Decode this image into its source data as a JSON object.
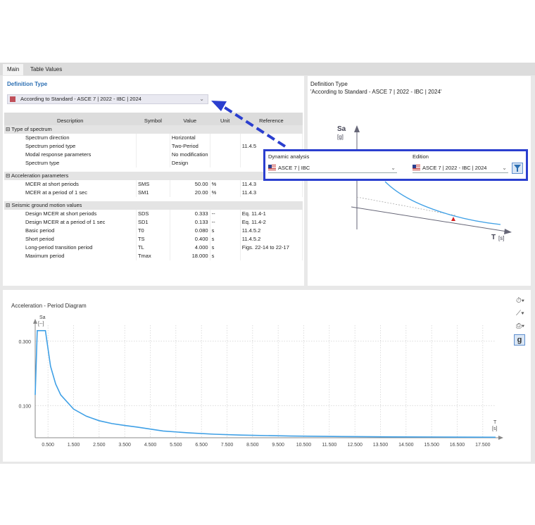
{
  "tabs": [
    "Main",
    "Table Values"
  ],
  "definition": {
    "title": "Definition Type",
    "selected": "According to Standard - ASCE 7 | 2022 - IBC | 2024"
  },
  "table": {
    "headers": [
      "Description",
      "Symbol",
      "Value",
      "Unit",
      "Reference"
    ],
    "groups": [
      {
        "title": "Type of spectrum",
        "rows": [
          {
            "desc": "Spectrum direction",
            "symbol": "",
            "value": "Horizontal",
            "unit": "",
            "ref": ""
          },
          {
            "desc": "Spectrum period type",
            "symbol": "",
            "value": "Two-Period",
            "unit": "",
            "ref": "11.4.5"
          },
          {
            "desc": "Modal response parameters",
            "symbol": "",
            "value": "No modification",
            "unit": "",
            "ref": ""
          },
          {
            "desc": "Spectrum type",
            "symbol": "",
            "value": "Design",
            "unit": "",
            "ref": ""
          }
        ]
      },
      {
        "title": "Acceleration parameters",
        "rows": [
          {
            "desc": "MCER at short periods",
            "symbol": "SMS",
            "value": "50.00",
            "unit": "%",
            "ref": "11.4.3"
          },
          {
            "desc": "MCER at a period of 1 sec",
            "symbol": "SM1",
            "value": "20.00",
            "unit": "%",
            "ref": "11.4.3"
          }
        ]
      },
      {
        "title": "Seismic ground motion values",
        "rows": [
          {
            "desc": "Design MCER at short periods",
            "symbol": "SDS",
            "value": "0.333",
            "unit": "--",
            "ref": "Eq. 11.4-1"
          },
          {
            "desc": "Design MCER at a period of 1 sec",
            "symbol": "SD1",
            "value": "0.133",
            "unit": "--",
            "ref": "Eq. 11.4-2"
          },
          {
            "desc": "Basic period",
            "symbol": "T0",
            "value": "0.080",
            "unit": "s",
            "ref": "11.4.5.2"
          },
          {
            "desc": "Short period",
            "symbol": "TS",
            "value": "0.400",
            "unit": "s",
            "ref": "11.4.5.2"
          },
          {
            "desc": "Long-period transition period",
            "symbol": "TL",
            "value": "4.000",
            "unit": "s",
            "ref": "Figs. 22-14 to 22-17"
          },
          {
            "desc": "Maximum period",
            "symbol": "Tmax",
            "value": "18.000",
            "unit": "s",
            "ref": ""
          }
        ]
      }
    ]
  },
  "preview": {
    "title": "Definition Type",
    "subtitle": "'According to Standard - ASCE 7 | 2022 - IBC | 2024'",
    "y_label": "Sa",
    "y_unit": "[g]",
    "x_label": "T",
    "x_unit": "[s]"
  },
  "popup": {
    "dynamic_label": "Dynamic analysis",
    "dynamic_value": "ASCE 7 | IBC",
    "edition_label": "Edition",
    "edition_value": "ASCE 7 | 2022 - IBC | 2024"
  },
  "diagram": {
    "title": "Acceleration - Period Diagram",
    "y_label": "Sa",
    "y_unit": "[--]",
    "x_label": "T",
    "x_unit": "[s]"
  },
  "chart_data": {
    "type": "line",
    "title": "Acceleration - Period Diagram",
    "xlabel": "T [s]",
    "ylabel": "Sa [--]",
    "xlim": [
      0,
      18.0
    ],
    "ylim": [
      0,
      0.35
    ],
    "x_ticks": [
      "0.500",
      "1.500",
      "2.500",
      "3.500",
      "4.500",
      "5.500",
      "6.500",
      "7.500",
      "8.500",
      "9.500",
      "10.500",
      "11.500",
      "12.500",
      "13.500",
      "14.500",
      "15.500",
      "16.500",
      "17.500"
    ],
    "y_ticks": [
      "0.100",
      "0.300"
    ],
    "x": [
      0,
      0.08,
      0.4,
      0.6,
      0.8,
      1.0,
      1.5,
      2.0,
      2.5,
      3.0,
      3.5,
      4.0,
      5.0,
      6.0,
      7.0,
      8.0,
      10.0,
      12.0,
      14.0,
      16.0,
      18.0
    ],
    "values": [
      0.133,
      0.333,
      0.333,
      0.222,
      0.167,
      0.133,
      0.089,
      0.067,
      0.053,
      0.044,
      0.038,
      0.033,
      0.021,
      0.015,
      0.011,
      0.0083,
      0.0053,
      0.0037,
      0.0027,
      0.0021,
      0.0016
    ],
    "color": "#3fa0e6",
    "grid": true
  },
  "colors": {
    "accent": "#2c6fb3",
    "popup_border": "#2b3fcf",
    "arrow": "#2b3fcf",
    "curve": "#3fa0e6"
  },
  "icons": [
    "clock-icon",
    "axis-icon",
    "print-icon",
    "g-icon",
    "filter-icon"
  ]
}
